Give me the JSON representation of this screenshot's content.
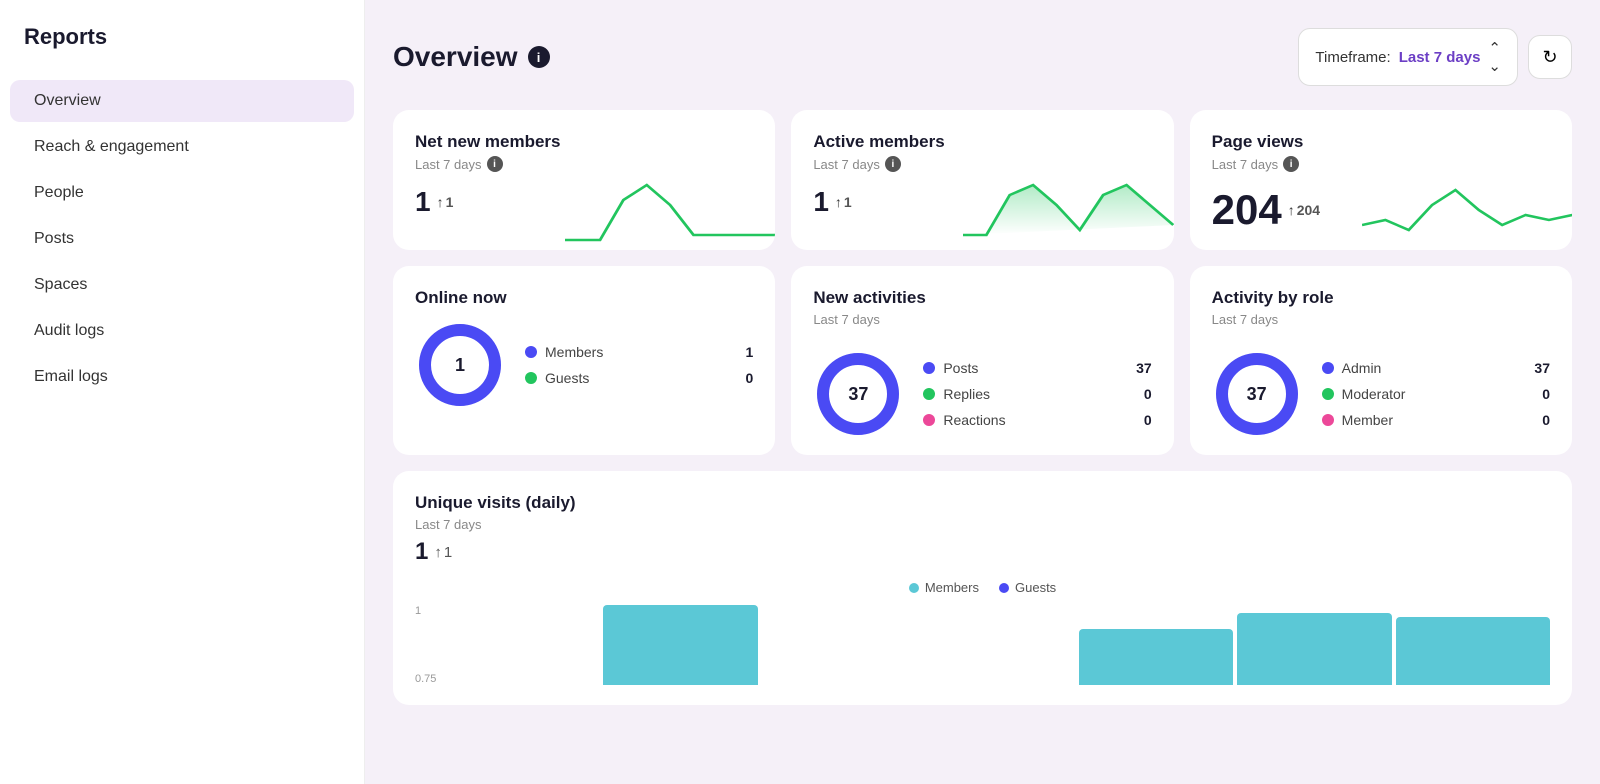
{
  "sidebar": {
    "title": "Reports",
    "items": [
      {
        "label": "Overview",
        "active": true
      },
      {
        "label": "Reach & engagement",
        "active": false
      },
      {
        "label": "People",
        "active": false
      },
      {
        "label": "Posts",
        "active": false
      },
      {
        "label": "Spaces",
        "active": false
      },
      {
        "label": "Audit logs",
        "active": false
      },
      {
        "label": "Email logs",
        "active": false
      }
    ]
  },
  "header": {
    "title": "Overview",
    "timeframe_label": "Timeframe:",
    "timeframe_value": "Last 7 days",
    "refresh_icon": "↻"
  },
  "stat_cards": [
    {
      "title": "Net new members",
      "subtitle": "Last 7 days",
      "value": "1",
      "change": "1"
    },
    {
      "title": "Active members",
      "subtitle": "Last 7 days",
      "value": "1",
      "change": "1"
    },
    {
      "title": "Page views",
      "subtitle": "Last 7 days",
      "value": "204",
      "change": "204"
    }
  ],
  "donut_cards": [
    {
      "title": "Online now",
      "subtitle": "",
      "center_value": "1",
      "segments": [
        {
          "label": "Members",
          "value": 1,
          "color": "#4a4af4"
        },
        {
          "label": "Guests",
          "value": 0,
          "color": "#22c55e"
        }
      ],
      "counts": [
        1,
        0
      ]
    },
    {
      "title": "New activities",
      "subtitle": "Last 7 days",
      "center_value": "37",
      "segments": [
        {
          "label": "Posts",
          "value": 37,
          "color": "#4a4af4"
        },
        {
          "label": "Replies",
          "value": 0,
          "color": "#22c55e"
        },
        {
          "label": "Reactions",
          "value": 0,
          "color": "#ec4899"
        }
      ],
      "counts": [
        37,
        0,
        0
      ]
    },
    {
      "title": "Activity by role",
      "subtitle": "Last 7 days",
      "center_value": "37",
      "segments": [
        {
          "label": "Admin",
          "value": 37,
          "color": "#4a4af4"
        },
        {
          "label": "Moderator",
          "value": 0,
          "color": "#22c55e"
        },
        {
          "label": "Member",
          "value": 0,
          "color": "#ec4899"
        }
      ],
      "counts": [
        37,
        0,
        0
      ]
    }
  ],
  "unique_visits": {
    "title": "Unique visits (daily)",
    "subtitle": "Last 7 days",
    "value": "1",
    "change": "1",
    "legend": [
      {
        "label": "Members",
        "color": "#5bc8d6"
      },
      {
        "label": "Guests",
        "color": "#4a4af4"
      }
    ],
    "y_labels": [
      "1",
      "0.75"
    ],
    "bars": [
      0,
      1,
      0,
      0,
      0.7,
      0.9,
      0.85
    ]
  }
}
